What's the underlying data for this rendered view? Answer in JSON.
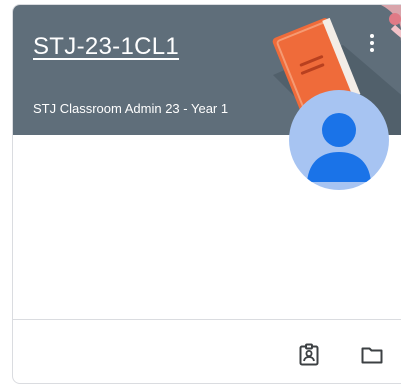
{
  "class_card": {
    "title": "STJ-23-1CL1",
    "subtitle": "STJ Classroom Admin 23 - Year 1",
    "banner_color": "#5f6e7a",
    "avatar_color": "#a7c4f2",
    "avatar_figure_color": "#1a73e8"
  },
  "footer": {
    "icons": [
      "assignment-ind-icon",
      "folder-icon"
    ]
  }
}
